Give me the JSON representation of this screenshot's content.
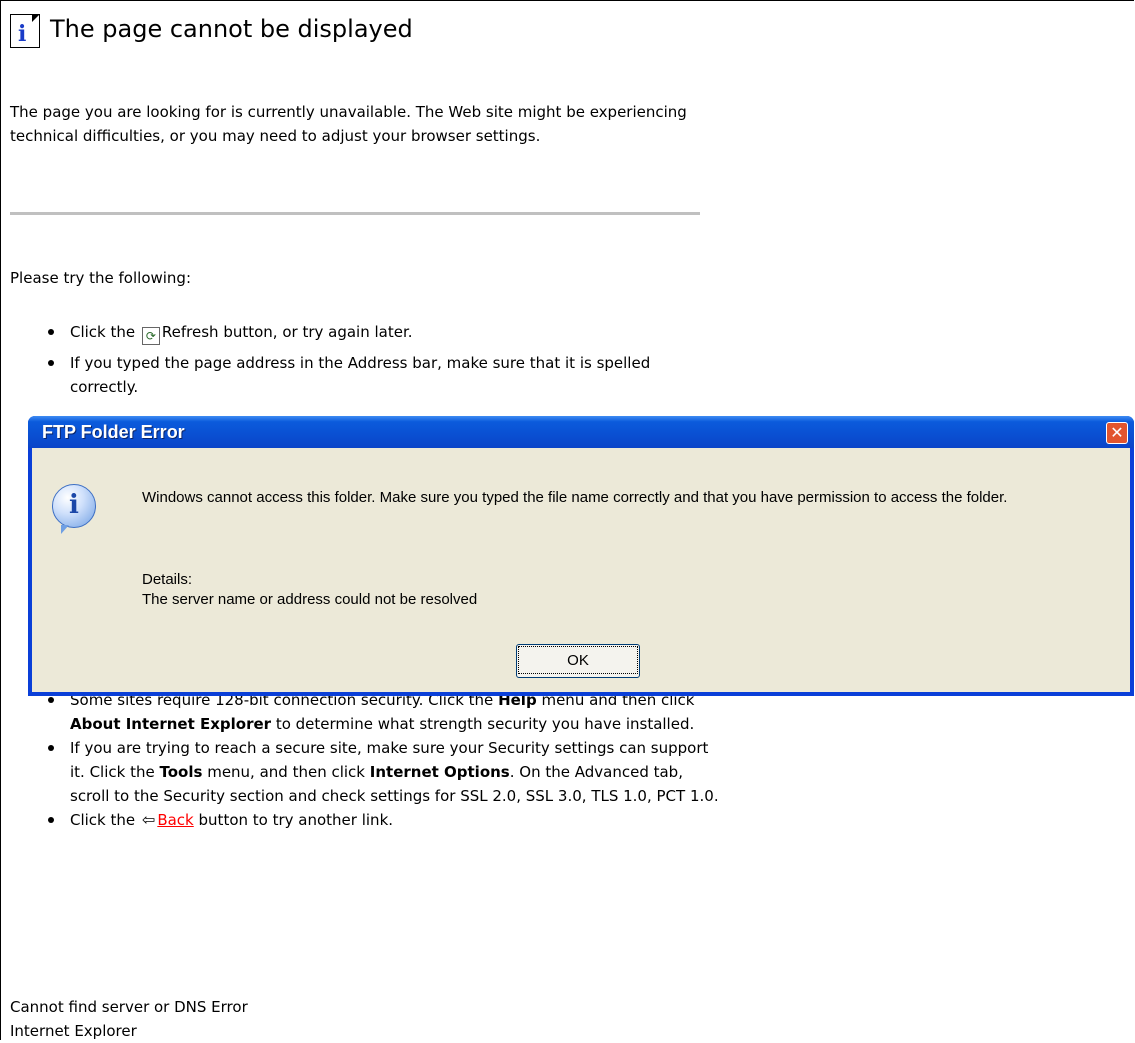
{
  "page": {
    "title": "The page cannot be displayed",
    "intro": "The page you are looking for is currently unavailable. The Web site might be experiencing technical difficulties, or you may need to adjust your browser settings.",
    "try_label": "Please try the following:",
    "bullet_1_prefix": "Click the",
    "bullet_1_suffix": "Refresh button, or try again later.",
    "bullet_2": "If you typed the page address in the Address bar, make sure that it is spelled correctly.",
    "bullet_3a": "Some sites require 128-bit connection security. Click the",
    "bullet_3_help": "Help",
    "bullet_3b": "menu and then click",
    "bullet_3_about": "About Internet Explorer",
    "bullet_3c": "to determine what strength security you have installed.",
    "bullet_4a": "If you are trying to reach a secure site, make sure your Security settings can support it. Click the",
    "bullet_4_tools": "Tools",
    "bullet_4b": "menu, and then click",
    "bullet_4_options": "Internet Options",
    "bullet_4c": ". On the Advanced tab, scroll to the Security section and check settings for SSL 2.0, SSL 3.0, TLS 1.0, PCT 1.0.",
    "bullet_5_prefix": "Click the",
    "back_link": "Back",
    "bullet_5_suffix": "button to try another link.",
    "footer_1": "Cannot find server or DNS Error",
    "footer_2": "Internet Explorer"
  },
  "dialog": {
    "title": "FTP Folder Error",
    "close_label": "✕",
    "message": "Windows cannot access this folder. Make sure you typed the file name correctly and that you have permission to access the folder.",
    "details_label": "Details:",
    "details_text": "The server name or address could not be resolved",
    "ok_label": "OK"
  }
}
